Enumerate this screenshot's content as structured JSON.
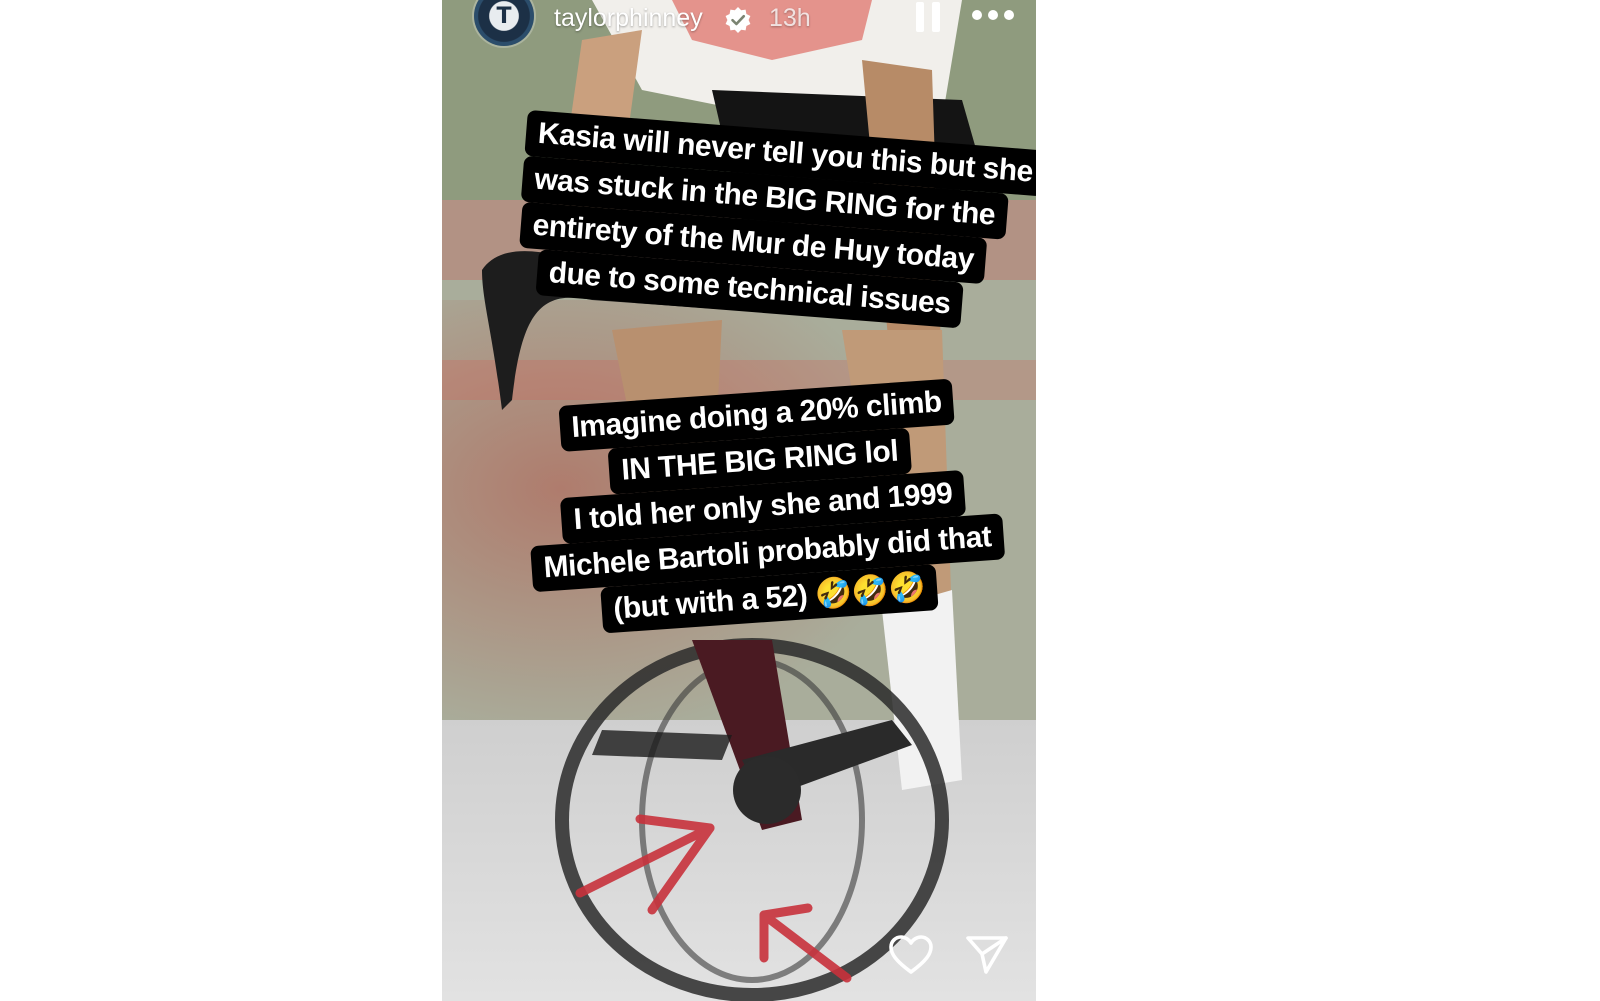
{
  "story": {
    "username": "taylorphinney",
    "time": "13h",
    "verified": true,
    "avatar_letter": "T"
  },
  "captions": {
    "first": [
      "Kasia will never tell you this but she",
      "was stuck in the BIG RING for the",
      "entirety of the Mur de Huy today",
      "due to some technical issues"
    ],
    "second": [
      "Imagine doing a 20% climb",
      "IN THE BIG RING lol",
      "I told her only she and 1999",
      "Michele Bartoli probably did that",
      "(but with a 52) 🤣🤣🤣"
    ]
  },
  "icons": {
    "pause": "pause-icon",
    "more": "more-icon",
    "like": "heart-icon",
    "share": "send-icon",
    "verified": "verified-badge-icon"
  },
  "colors": {
    "caption_bg": "#000000",
    "caption_text": "#ffffff",
    "arrow": "#c8323c"
  }
}
